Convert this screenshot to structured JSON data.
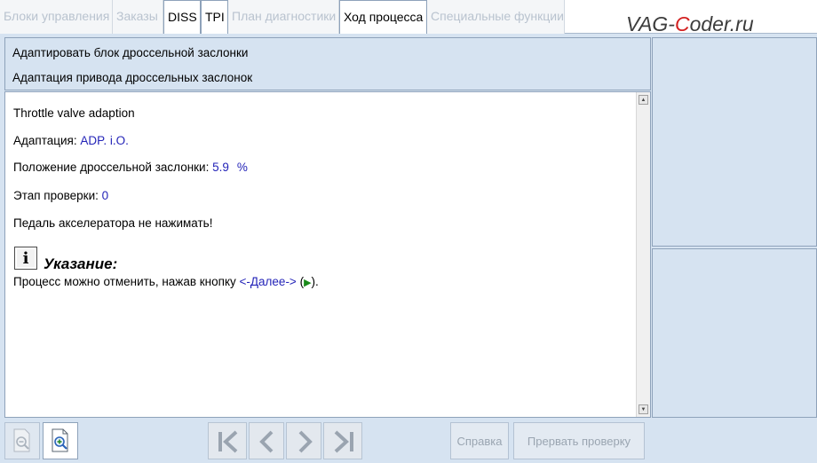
{
  "tabs": [
    {
      "label": "Блоки управления",
      "active": false
    },
    {
      "label": "Заказы",
      "active": false
    },
    {
      "label": "DISS",
      "active": true
    },
    {
      "label": "TPI",
      "active": true
    },
    {
      "label": "План диагностики",
      "active": false
    },
    {
      "label": "Ход процесса",
      "active": true
    },
    {
      "label": "Специальные функции",
      "active": false
    }
  ],
  "logo": {
    "part1": "VAG-",
    "part2": "C",
    "part3": "oder.ru"
  },
  "header": {
    "line1": "Адаптировать блок дроссельной заслонки",
    "line2": "Адаптация привода дроссельных заслонок"
  },
  "content": {
    "title": "Throttle valve adaption",
    "adaptation_label": "Адаптация: ",
    "adaptation_value": "ADP. i.O.",
    "position_label": "Положение дроссельной заслонки: ",
    "position_value": "5.9",
    "position_unit": "%",
    "step_label": "Этап проверки: ",
    "step_value": "0",
    "pedal_text": "Педаль акселератора не нажимать!",
    "notice_title": "Указание:",
    "notice_text_a": "Процесс можно отменить, нажав кнопку ",
    "notice_link": "<-Далее->",
    "notice_text_b": " (",
    "notice_text_c": ")."
  },
  "toolbar": {
    "help_label": "Справка",
    "abort_label": "Прервать проверку"
  },
  "colors": {
    "accent_value": "#2424b8",
    "panel_bg": "#d6e3f1",
    "border": "#8ea2ba",
    "logo_c": "#d32020"
  }
}
